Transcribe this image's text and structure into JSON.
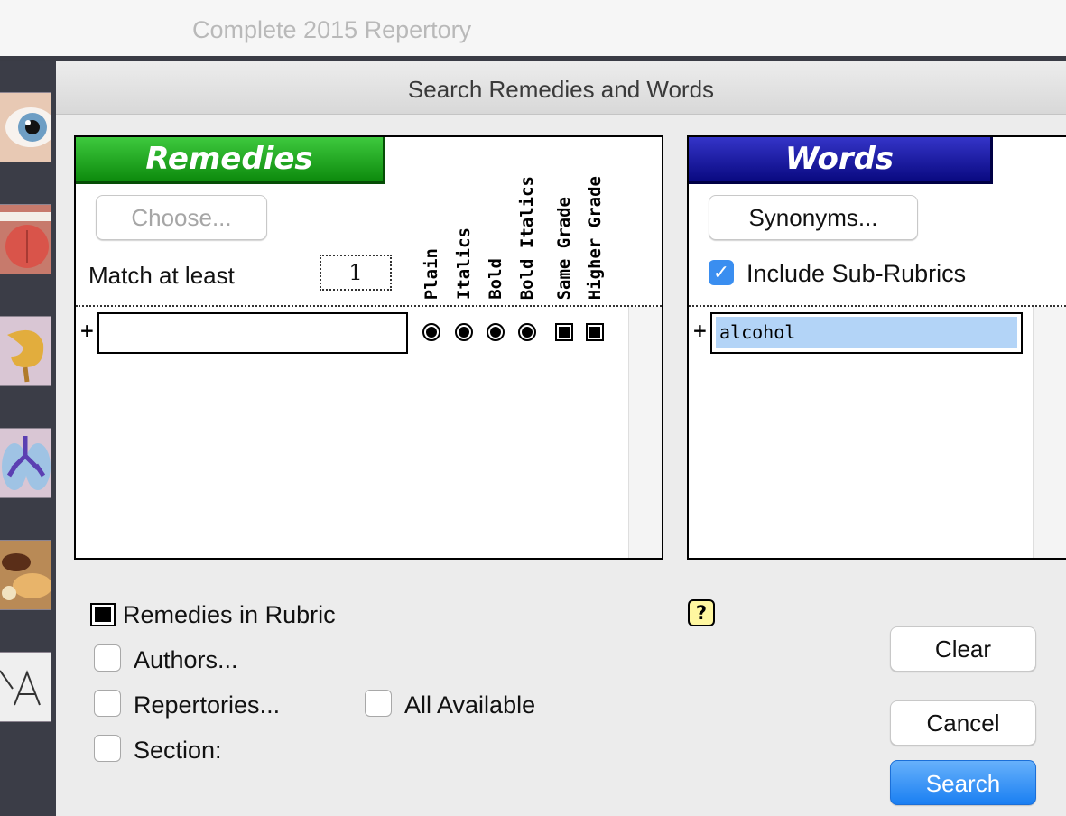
{
  "app": {
    "window_title": "Complete 2015 Repertory"
  },
  "dialog": {
    "title": "Search Remedies and Words",
    "remedies": {
      "header": "Remedies",
      "choose_label": "Choose...",
      "match_label": "Match at least",
      "match_value": "1",
      "grade_columns": [
        "Plain",
        "Italics",
        "Bold",
        "Bold Italics",
        "Same Grade",
        "Higher Grade"
      ],
      "row_value": ""
    },
    "words": {
      "header": "Words",
      "synonyms_label": "Synonyms...",
      "include_sub_rubrics_label": "Include Sub-Rubrics",
      "include_sub_rubrics_checked": true,
      "row_value": "alcohol"
    },
    "options": {
      "remedies_in_rubric": "Remedies in Rubric",
      "authors": "Authors...",
      "repertories": "Repertories...",
      "all_available": "All Available",
      "section": "Section:"
    },
    "buttons": {
      "clear": "Clear",
      "cancel": "Cancel",
      "search": "Search"
    },
    "help_glyph": "?"
  },
  "colors": {
    "remedies_header": "#0d8a0d",
    "words_header": "#090980",
    "accent": "#1a7ff2"
  },
  "icons": [
    "eye-icon",
    "tongue-icon",
    "stomach-icon",
    "lungs-icon",
    "food-icon",
    "letters-icon",
    "help-icon",
    "plus-icon",
    "checkmark-icon"
  ]
}
